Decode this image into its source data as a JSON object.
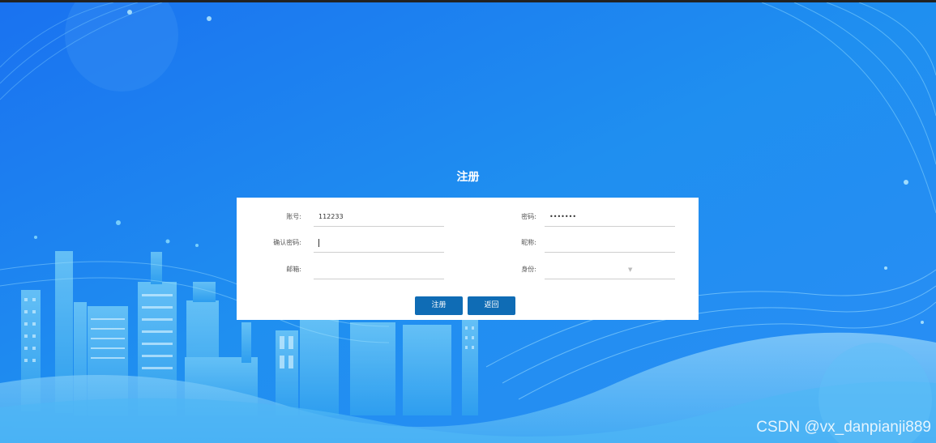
{
  "page": {
    "title": "注册"
  },
  "form": {
    "account": {
      "label": "账号:",
      "value": "112233"
    },
    "password": {
      "label": "密码:",
      "value": "•••••••"
    },
    "confirm_password": {
      "label": "确认密码:",
      "value": ""
    },
    "nickname": {
      "label": "昵称:",
      "value": ""
    },
    "email": {
      "label": "邮箱:",
      "value": ""
    },
    "role": {
      "label": "身份:",
      "value": ""
    }
  },
  "buttons": {
    "register": "注册",
    "back": "返回"
  },
  "watermark": "CSDN @vx_danpianji889",
  "colors": {
    "background": "#1e7ff0",
    "button": "#0f6cb5",
    "panel": "#ffffff"
  }
}
